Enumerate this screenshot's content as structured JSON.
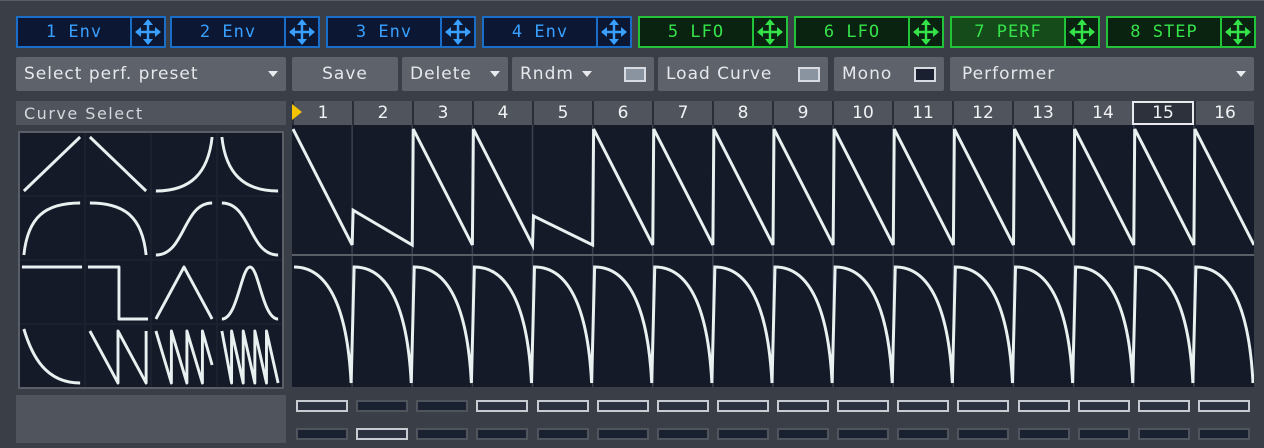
{
  "mod_tabs": [
    {
      "label": "1 Env",
      "kind": "env",
      "active": false
    },
    {
      "label": "2 Env",
      "kind": "env",
      "active": false
    },
    {
      "label": "3 Env",
      "kind": "env",
      "active": false
    },
    {
      "label": "4 Env",
      "kind": "env",
      "active": false
    },
    {
      "label": "5 LFO",
      "kind": "lfo",
      "active": false
    },
    {
      "label": "6 LFO",
      "kind": "lfo",
      "active": false
    },
    {
      "label": "7 PERF",
      "kind": "lfo",
      "active": true
    },
    {
      "label": "8 STEP",
      "kind": "lfo",
      "active": false
    }
  ],
  "toolbar": {
    "preset_label": "Select perf. preset",
    "save_label": "Save",
    "delete_label": "Delete",
    "rndm_label": "Rndm",
    "load_curve_label": "Load Curve",
    "mono_label": "Mono",
    "performer_label": "Performer"
  },
  "curve_select": {
    "header": "Curve Select",
    "curves": [
      "ramp-up",
      "ramp-down",
      "exp-up",
      "exp-down",
      "log-up",
      "log-down",
      "s-curve-up",
      "s-curve-down",
      "flat-high",
      "step-down",
      "triangle",
      "bell",
      "decay",
      "saw-x2",
      "saw-x3",
      "saw-x4"
    ]
  },
  "steps": {
    "labels": [
      "1",
      "2",
      "3",
      "4",
      "5",
      "6",
      "7",
      "8",
      "9",
      "10",
      "11",
      "12",
      "13",
      "14",
      "15",
      "16"
    ],
    "selected": "15",
    "lane1": [
      1.0,
      0.3,
      1.0,
      1.0,
      0.25,
      1.0,
      1.0,
      1.0,
      1.0,
      1.0,
      1.0,
      1.0,
      1.0,
      1.0,
      1.0,
      1.0
    ],
    "row1": [
      true,
      false,
      false,
      true,
      true,
      true,
      true,
      true,
      true,
      true,
      true,
      true,
      true,
      true,
      true,
      true
    ],
    "row2": [
      false,
      true,
      false,
      false,
      false,
      false,
      false,
      false,
      false,
      false,
      false,
      false,
      false,
      false,
      false,
      false
    ]
  },
  "colors": {
    "env": "#39a0ff",
    "lfo": "#36e24a",
    "playhead": "#f5c400",
    "curve": "#e8f0f0"
  }
}
